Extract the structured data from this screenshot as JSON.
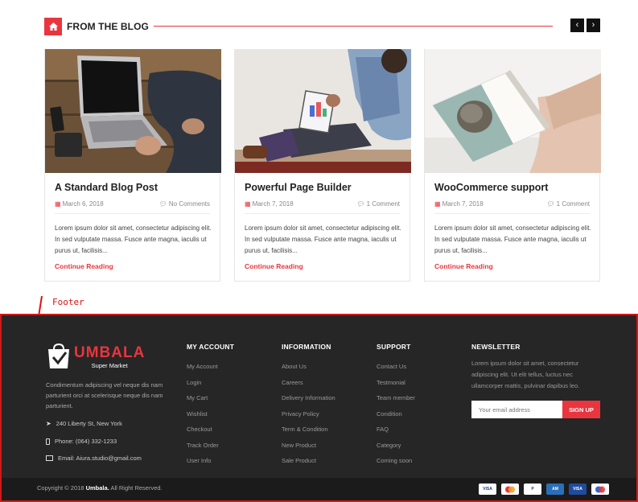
{
  "blog": {
    "heading": "FROM THE BLOG",
    "prev": "‹",
    "next": "›",
    "posts": [
      {
        "title": "A Standard Blog Post",
        "date": "March 6, 2018",
        "comments": "No Comments",
        "excerpt": "Lorem ipsum dolor sit amet, consectetur adipiscing elit. In sed vulputate massa. Fusce ante magna, iaculis ut purus ut, facilisis...",
        "link": "Continue Reading"
      },
      {
        "title": "Powerful Page Builder",
        "date": "March 7, 2018",
        "comments": "1 Comment",
        "excerpt": "Lorem ipsum dolor sit amet, consectetur adipiscing elit. In sed vulputate massa. Fusce ante magna, iaculis ut purus ut, facilisis...",
        "link": "Continue Reading"
      },
      {
        "title": "WooCommerce support",
        "date": "March 7, 2018",
        "comments": "1 Comment",
        "excerpt": "Lorem ipsum dolor sit amet, consectetur adipiscing elit. In sed vulputate massa. Fusce ante magna, iaculis ut purus ut, facilisis...",
        "link": "Continue Reading"
      }
    ]
  },
  "annotation": {
    "label": "Footer"
  },
  "footer": {
    "logo": {
      "name": "UMBALA",
      "sub": "Super Market"
    },
    "about": "Condimentum adipiscing vel neque dis nam parturient orci at scelerisque neque dis nam parturient.",
    "address": "240 Liberty St, New York",
    "phone": "Phone: (064) 332-1233",
    "email": "Email: Aiura.studio@gmail.com",
    "columns": [
      {
        "title": "MY ACCOUNT",
        "items": [
          "My Account",
          "Login",
          "My Cart",
          "Wishlist",
          "Checkout",
          "Track Order",
          "User Info"
        ]
      },
      {
        "title": "INFORMATION",
        "items": [
          "About Us",
          "Careers",
          "Delivery Information",
          "Privacy Policy",
          "Term & Condition",
          "New Product",
          "Sale Product"
        ]
      },
      {
        "title": "SUPPORT",
        "items": [
          "Contact Us",
          "Testmonial",
          "Team member",
          "Condition",
          "FAQ",
          "Category",
          "Coming soon"
        ]
      }
    ],
    "newsletter": {
      "title": "NEWSLETTER",
      "text": "Lorem ipsum dolor sit amet, consectetur adipiscing elit. Ut elit tellus, luctus nec ullamcorper mattis, pulvinar dapibus leo.",
      "placeholder": "Your email address",
      "button": "SIGN UP"
    },
    "copyright_pre": "Copyright © 2018",
    "copyright_brand": "Umbala.",
    "copyright_post": "All Right Reserved.",
    "payments": [
      "VISA",
      "MC",
      "PayPal",
      "AMEX",
      "VISA",
      "Maestro"
    ]
  },
  "colors": {
    "accent": "#e9353e",
    "footer_bg": "#262626"
  }
}
